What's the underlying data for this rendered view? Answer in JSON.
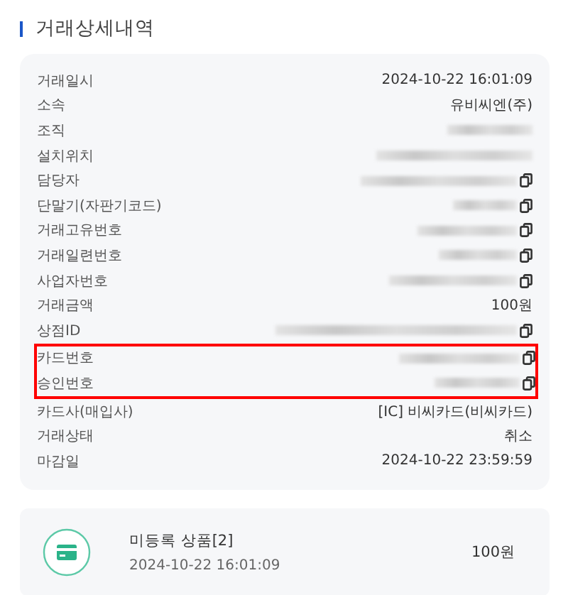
{
  "section_title": "거래상세내역",
  "details": [
    {
      "label": "거래일시",
      "kind": "text",
      "value": "2024-10-22 16:01:09",
      "copyable": false,
      "highlighted": false
    },
    {
      "label": "소속",
      "kind": "text",
      "value": "유비씨엔(주)",
      "copyable": false,
      "highlighted": false
    },
    {
      "label": "조직",
      "kind": "redacted",
      "copyable": false,
      "highlighted": false
    },
    {
      "label": "설치위치",
      "kind": "redacted",
      "copyable": false,
      "highlighted": false
    },
    {
      "label": "담당자",
      "kind": "redacted",
      "copyable": true,
      "highlighted": false
    },
    {
      "label": "단말기(자판기코드)",
      "kind": "redacted",
      "copyable": true,
      "highlighted": false
    },
    {
      "label": "거래고유번호",
      "kind": "redacted",
      "copyable": true,
      "highlighted": false
    },
    {
      "label": "거래일련번호",
      "kind": "redacted",
      "copyable": true,
      "highlighted": false
    },
    {
      "label": "사업자번호",
      "kind": "redacted",
      "copyable": true,
      "highlighted": false
    },
    {
      "label": "거래금액",
      "kind": "text",
      "value": "100원",
      "copyable": false,
      "highlighted": false
    },
    {
      "label": "상점ID",
      "kind": "redacted",
      "copyable": true,
      "highlighted": false
    },
    {
      "label": "카드번호",
      "kind": "redacted",
      "copyable": true,
      "highlighted": true
    },
    {
      "label": "승인번호",
      "kind": "redacted",
      "copyable": true,
      "highlighted": true
    },
    {
      "label": "카드사(매입사)",
      "kind": "text",
      "value": "[IC] 비씨카드(비씨카드)",
      "copyable": false,
      "highlighted": false
    },
    {
      "label": "거래상태",
      "kind": "text",
      "value": "취소",
      "copyable": false,
      "highlighted": false
    },
    {
      "label": "마감일",
      "kind": "text",
      "value": "2024-10-22 23:59:59",
      "copyable": false,
      "highlighted": false
    }
  ],
  "item": {
    "name": "미등록 상품[2]",
    "time": "2024-10-22 16:01:09",
    "amount": "100원"
  }
}
